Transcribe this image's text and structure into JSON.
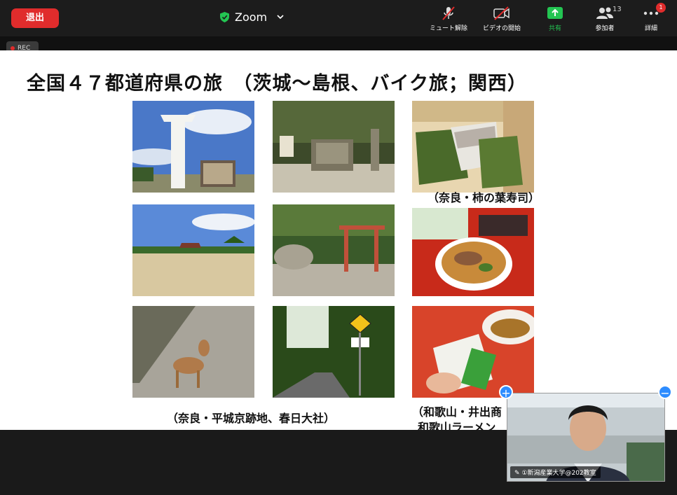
{
  "toolbar": {
    "leave_label": "退出",
    "app_title": "Zoom",
    "mute_label": "ミュート解除",
    "video_label": "ビデオの開始",
    "share_label": "共有",
    "participants_label": "参加者",
    "participants_count": "13",
    "more_label": "詳細",
    "more_badge": "1"
  },
  "recording": {
    "label": "REC"
  },
  "slide": {
    "title": "全国４７都道府県の旅　（茨城～島根、バイク旅；関西）",
    "captions": {
      "kaki": "（奈良・柿の葉寿司）",
      "heijo": "（奈良・平城京跡地、春日大社）",
      "wakayama_line1": "（和歌山・井出商",
      "wakayama_line2": "和歌山ラーメン"
    }
  },
  "video_tile": {
    "name": "①新潟産業大学@202教室"
  },
  "colors": {
    "leave": "#e02c2c",
    "share": "#23c552",
    "accent": "#2d8cff"
  }
}
